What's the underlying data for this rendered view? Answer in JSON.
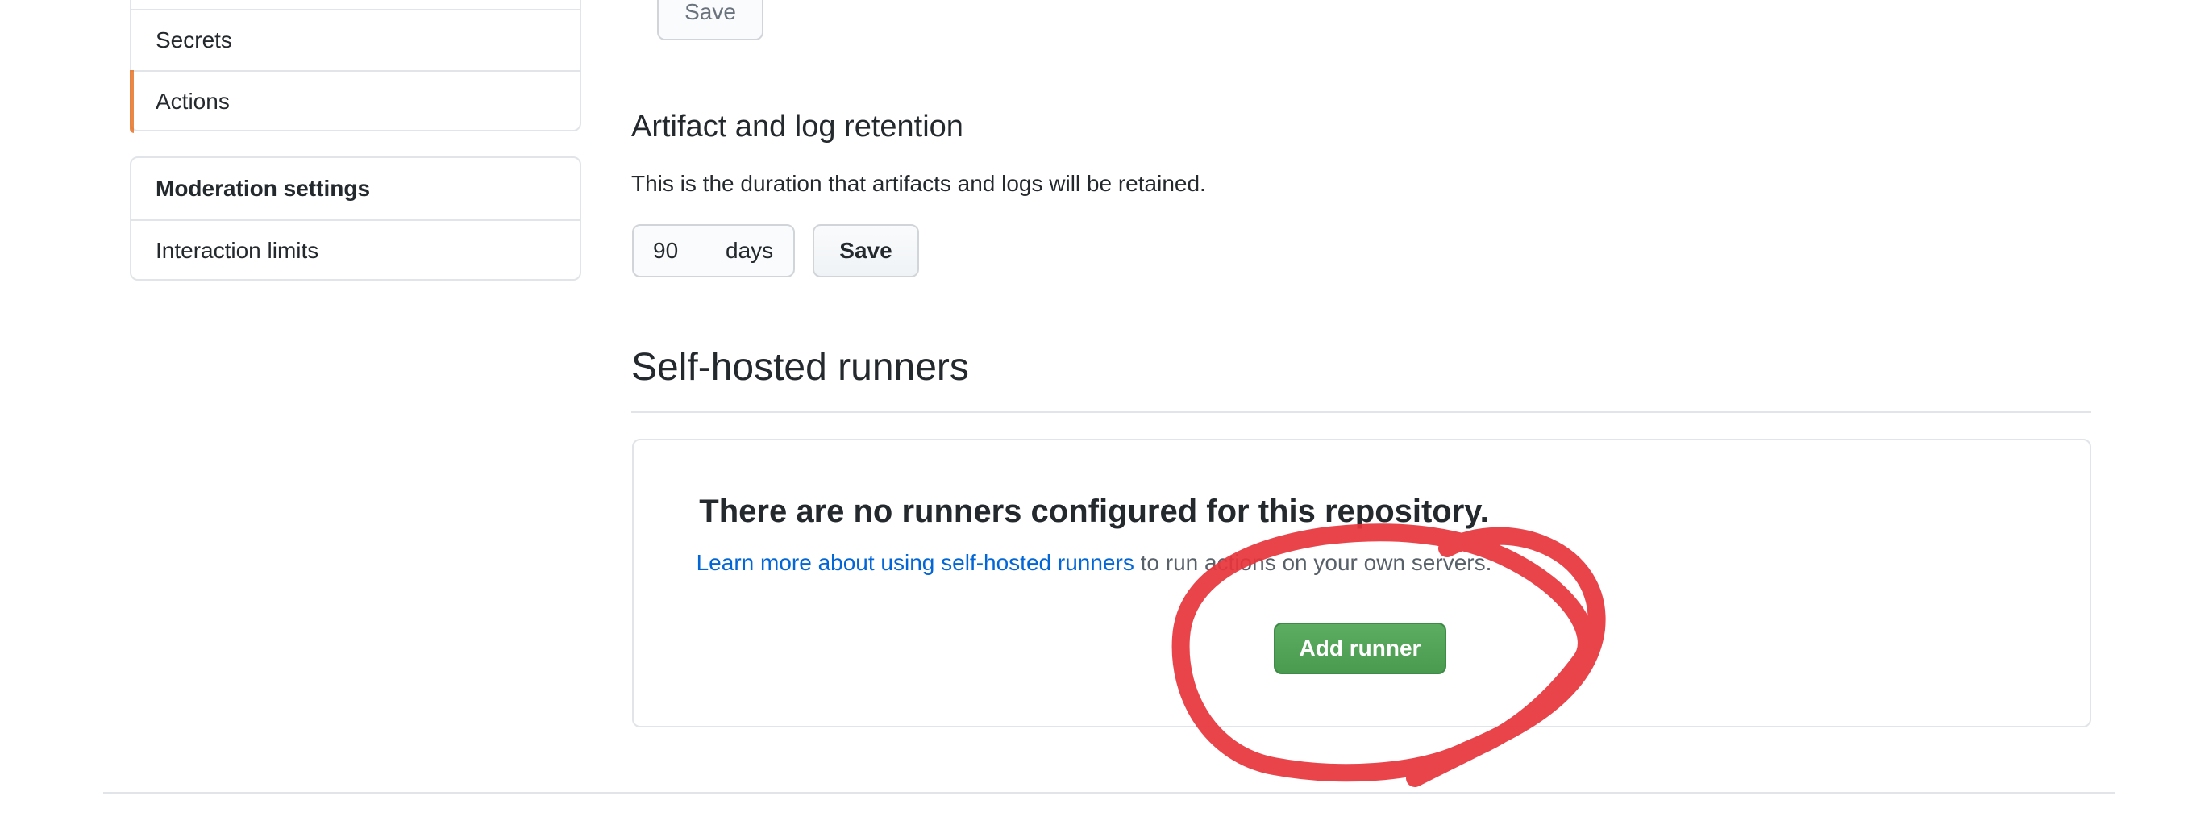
{
  "sidebar": {
    "items": [
      {
        "label": "Secrets"
      },
      {
        "label": "Actions"
      }
    ],
    "moderation": {
      "heading": "Moderation settings",
      "items": [
        {
          "label": "Interaction limits"
        }
      ]
    }
  },
  "top_save_label": "Save",
  "artifact": {
    "title": "Artifact and log retention",
    "description": "This is the duration that artifacts and logs will be retained.",
    "days_value": "90",
    "days_unit": "days",
    "save_label": "Save"
  },
  "runners": {
    "title": "Self-hosted runners",
    "empty_title": "There are no runners configured for this repository.",
    "learn_link": "Learn more about using self-hosted runners",
    "learn_suffix": " to run actions on your own servers.",
    "add_label": "Add runner"
  },
  "colors": {
    "accent_selected": "#e36209",
    "primary_button": "#4a9a50",
    "link": "#0366d6",
    "annotation": "#e8343c"
  }
}
